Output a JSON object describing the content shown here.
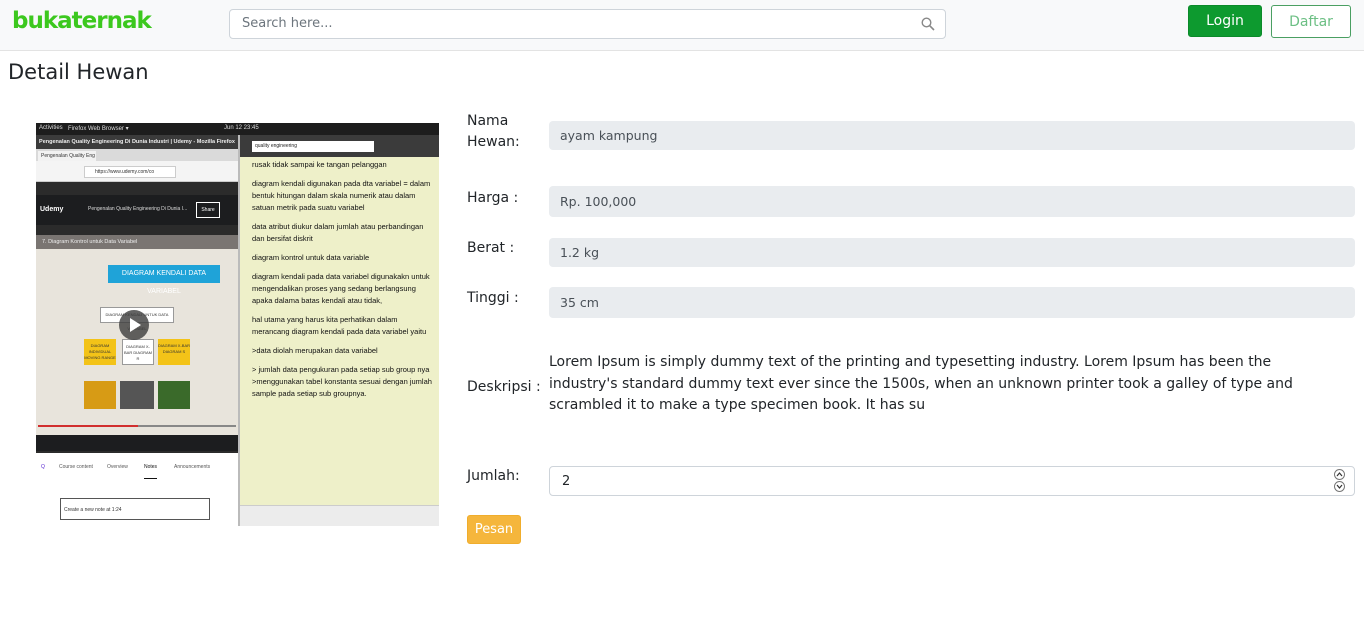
{
  "navbar": {
    "brand": "bukaternak",
    "search_placeholder": "Search here...",
    "login_label": "Login",
    "daftar_label": "Daftar",
    "search_icon": "search-icon"
  },
  "page_title": "Detail Hewan",
  "screenshot": {
    "topbar_activities": "Activities",
    "topbar_browser": "Firefox Web Browser ▾",
    "topbar_clock": "Jun 12  23:45",
    "window_title": "Pengenalan Quality Engineering Di Dunia Industri | Udemy - Mozilla Firefox",
    "tab_label": "Pengenalan Quality Eng ×",
    "url": "https://www.udemy.com/co",
    "udemy_brand": "Udemy",
    "course_title": "Pengenalan Quality Engineering Di Dunia I...",
    "share_label": "Share",
    "video_header": "7. Diagram Kontrol untuk Data Variabel",
    "diagram_title": "DIAGRAM KENDALI DATA VARIABEL",
    "diagram_sub": "DIAGRAM KENDALI UNTUK DATA VARIABEL",
    "box1": "DIAGRAM INDIVIDUAL MOVING RANGE",
    "box2": "DIAGRAM X-BAR DIAGRAM R",
    "box3": "DIAGRAM X-BAR DIAGRAM S",
    "tabs": [
      "Course content",
      "Overview",
      "Notes",
      "Announcements"
    ],
    "note_placeholder": "Create a new note at 1:24",
    "pane_search": "quality engineering",
    "pane_lines": [
      "rusak tidak sampai ke tangan pelanggan",
      "diagram kendali digunakan pada dta variabel = dalam bentuk hitungan dalam skala numerik atau dalam satuan metrik pada suatu variabel",
      "data atribut diukur dalam jumlah atau perbandingan dan bersifat diskrit",
      "diagram kontrol untuk data variable",
      " diagram kendali pada data variabel digunakakn untuk mengendalikan proses yang sedang berlangsung apaka dalama batas kendali atau tidak,",
      "hal utama yang harus kita perhatikan dalam merancang diagram kendali pada data variabel yaitu",
      ">data diolah merupakan data variabel",
      "> jumlah data pengukuran pada setiap sub group nya >menggunakan tabel konstanta sesuai dengan jumlah sample pada setiap sub groupnya."
    ]
  },
  "detail": {
    "nama_label_1": "Nama",
    "nama_label_2": "Hewan:",
    "nama_value": "ayam kampung",
    "harga_label": "Harga :",
    "harga_value": "Rp. 100,000",
    "berat_label": "Berat :",
    "berat_value": "1.2 kg",
    "tinggi_label": "Tinggi :",
    "tinggi_value": "35 cm",
    "deskripsi_label": "Deskripsi :",
    "deskripsi_value": "Lorem Ipsum is simply dummy text of the printing and typesetting industry. Lorem Ipsum has been the industry's standard dummy text ever since the 1500s, when an unknown printer took a galley of type and scrambled it to make a type specimen book. It has su",
    "jumlah_label": "Jumlah:",
    "jumlah_value": "2",
    "pesan_label": "Pesan"
  },
  "colors": {
    "brand": "#3cc81e",
    "login": "#0d9a2f",
    "pesan": "#f5b63c",
    "readonly_bg": "#e9ecef"
  }
}
